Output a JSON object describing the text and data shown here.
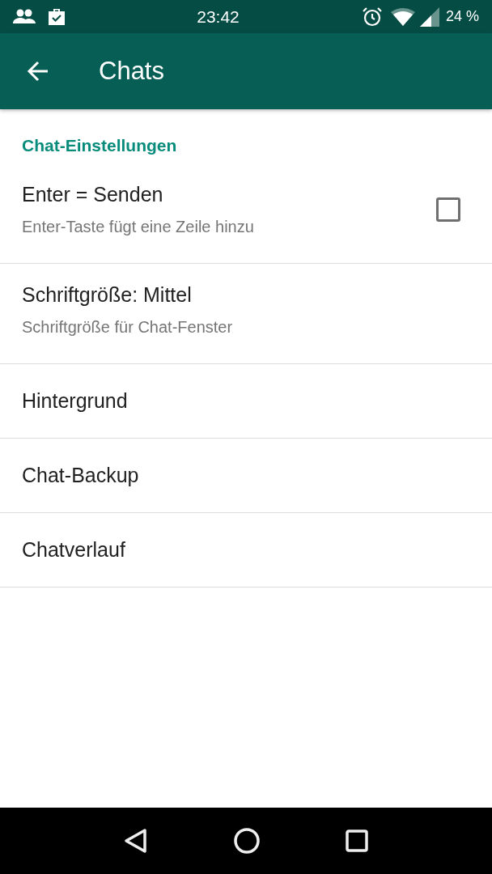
{
  "status_bar": {
    "time": "23:42",
    "battery": "24 %"
  },
  "app_bar": {
    "title": "Chats"
  },
  "section": {
    "title": "Chat-Einstellungen"
  },
  "items": [
    {
      "kind": "checkbox",
      "title": "Enter = Senden",
      "subtitle": "Enter-Taste fügt eine Zeile hinzu",
      "checked": false
    },
    {
      "kind": "detail",
      "title": "Schriftgröße: Mittel",
      "subtitle": "Schriftgröße für Chat-Fenster"
    },
    {
      "kind": "plain",
      "title": "Hintergrund"
    },
    {
      "kind": "plain",
      "title": "Chat-Backup"
    },
    {
      "kind": "plain",
      "title": "Chatverlauf"
    }
  ]
}
